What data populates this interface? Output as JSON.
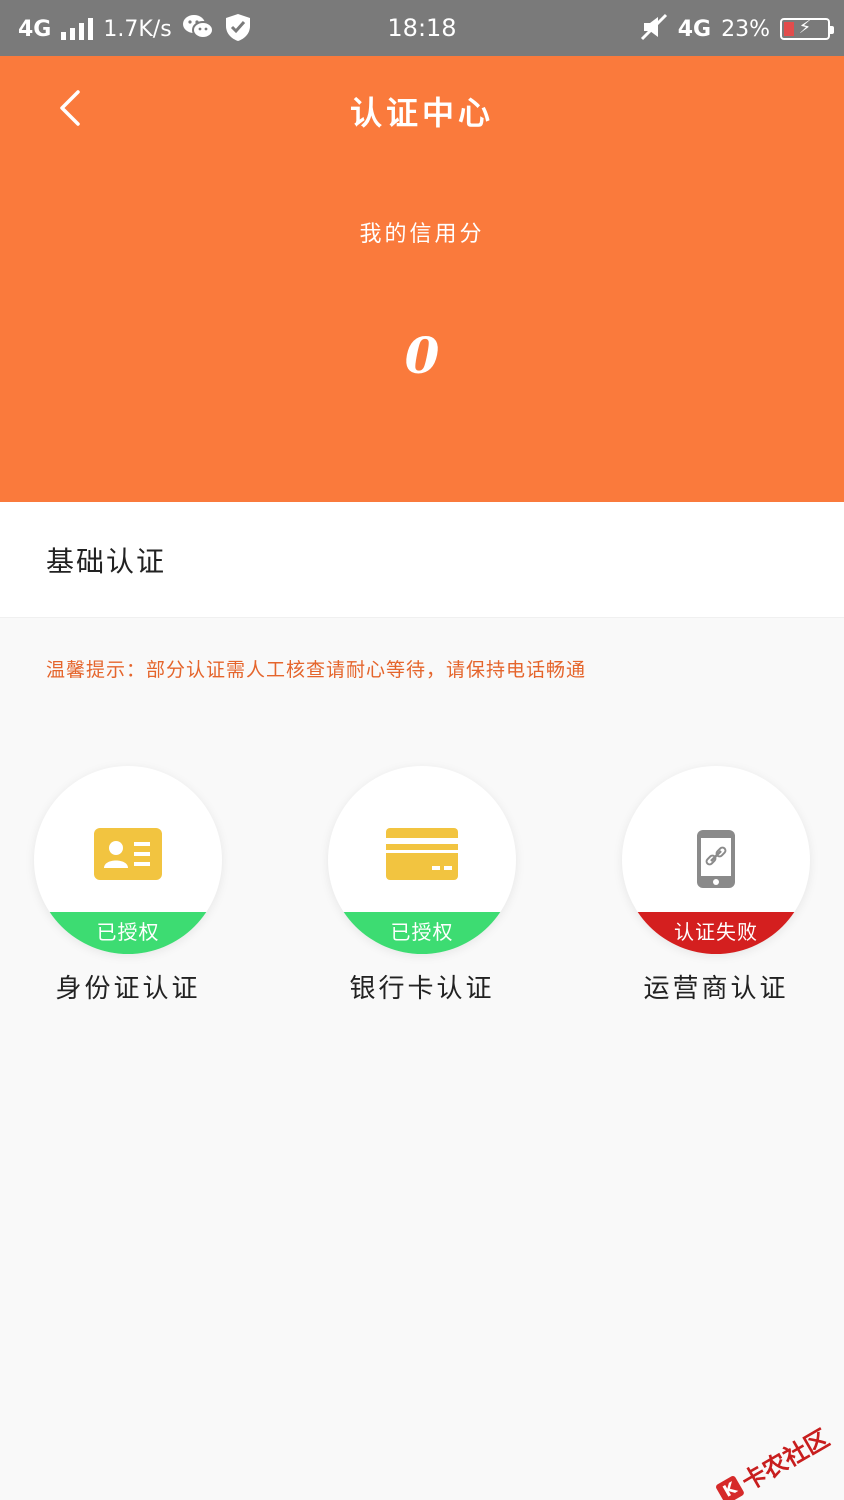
{
  "status_bar": {
    "network_left": "4G",
    "speed": "1.7K/s",
    "time": "18:18",
    "network_right": "4G",
    "battery_percent": "23%",
    "battery_level": 0.23
  },
  "header": {
    "title": "认证中心",
    "score_label": "我的信用分",
    "score_value": "0",
    "background_color": "#fa7a3c"
  },
  "section": {
    "title": "基础认证",
    "tip": "温馨提示：部分认证需人工核查请耐心等待，请保持电话畅通"
  },
  "auth_items": [
    {
      "label": "身份证认证",
      "status": "已授权",
      "status_color": "#3ddc72",
      "icon": "id-card-icon"
    },
    {
      "label": "银行卡认证",
      "status": "已授权",
      "status_color": "#3ddc72",
      "icon": "bank-card-icon"
    },
    {
      "label": "运营商认证",
      "status": "认证失败",
      "status_color": "#d41f1f",
      "icon": "phone-link-icon"
    }
  ],
  "watermark": {
    "text": "卡农社区",
    "icon_text": "K"
  }
}
